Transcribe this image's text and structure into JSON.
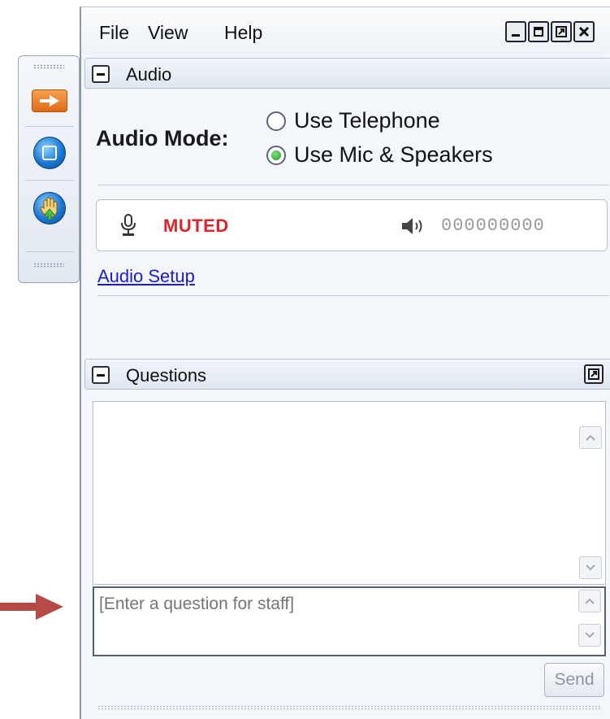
{
  "menu": {
    "file": "File",
    "view": "View",
    "help": "Help"
  },
  "audio": {
    "section_title": "Audio",
    "mode_label": "Audio Mode:",
    "options": [
      {
        "label": "Use Telephone",
        "selected": false
      },
      {
        "label": "Use Mic & Speakers",
        "selected": true
      }
    ],
    "mic_status": "MUTED",
    "phone_number": "000000000",
    "setup_link": "Audio Setup"
  },
  "questions": {
    "section_title": "Questions",
    "input_placeholder": "[Enter a question for staff]",
    "send_label": "Send"
  },
  "colors": {
    "muted": "#e0232a",
    "link": "#1a1ad8",
    "accent_orange": "#e97a27",
    "arrow": "#b84a45"
  },
  "icons": {
    "toolbar": [
      "arrow-right-icon",
      "stop-square-icon",
      "raise-hand-icon"
    ],
    "window": [
      "minimize-icon",
      "maximize-icon",
      "restore-icon",
      "close-icon"
    ],
    "status": [
      "microphone-icon",
      "speaker-icon"
    ]
  }
}
